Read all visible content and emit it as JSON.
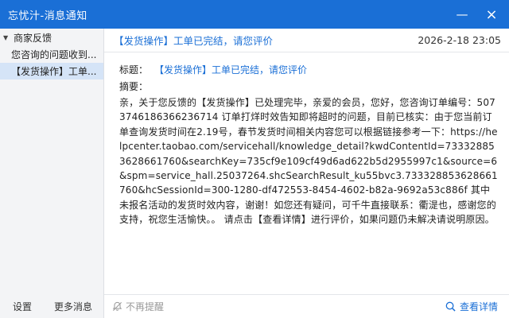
{
  "window": {
    "title": "忘忧汁-消息通知",
    "minimize_icon": "—",
    "close_icon": "×"
  },
  "sidebar": {
    "group_label": "商家反馈",
    "items": [
      {
        "label": "您咨询的问题收到..."
      },
      {
        "label": "【发货操作】工单..."
      }
    ],
    "footer": {
      "settings_label": "设置",
      "more_label": "更多消息"
    }
  },
  "message": {
    "header_title": "【发货操作】工单已完结，请您评价",
    "header_time": "2026-2-18 23:05",
    "subject_label": "标题：",
    "subject_value": "【发货操作】工单已完结，请您评价",
    "summary_label": "摘要：",
    "body": "亲，关于您反馈的【发货操作】已处理完毕，亲爱的会员，您好，您咨询订单编号：5073746186366236714 订单打烊时效告知即将超时的问题，目前已核实：由于您当前订单查询发货时间在2.19号，春节发货时间相关内容您可以根据链接参考一下：https://helpcenter.taobao.com/servicehall/knowledge_detail?kwdContentId=733328853628661760&searchKey=735cf9e109cf49d6ad622b5d2955997c1&source=6&spm=service_hall.25037264.shcSearchResult_ku55bvc3.733328853628661760&hcSessionId=300-1280-df472553-8454-4602-b82a-9692a53c886f 其中未报名活动的发货时效内容，谢谢！如您还有疑问，可千牛直接联系：衢湜也，感谢您的支持，祝您生活愉快。。 请点击【查看详情】进行评价，如果问题仍未解决请说明原因。"
  },
  "footer": {
    "mute_label": "不再提醒",
    "details_label": "查看详情"
  },
  "colors": {
    "titlebar": "#1a6fd6",
    "accent": "#1a6fd6",
    "sidebar_bg": "#f3f4f6",
    "selected_bg": "#d5e4f7"
  }
}
